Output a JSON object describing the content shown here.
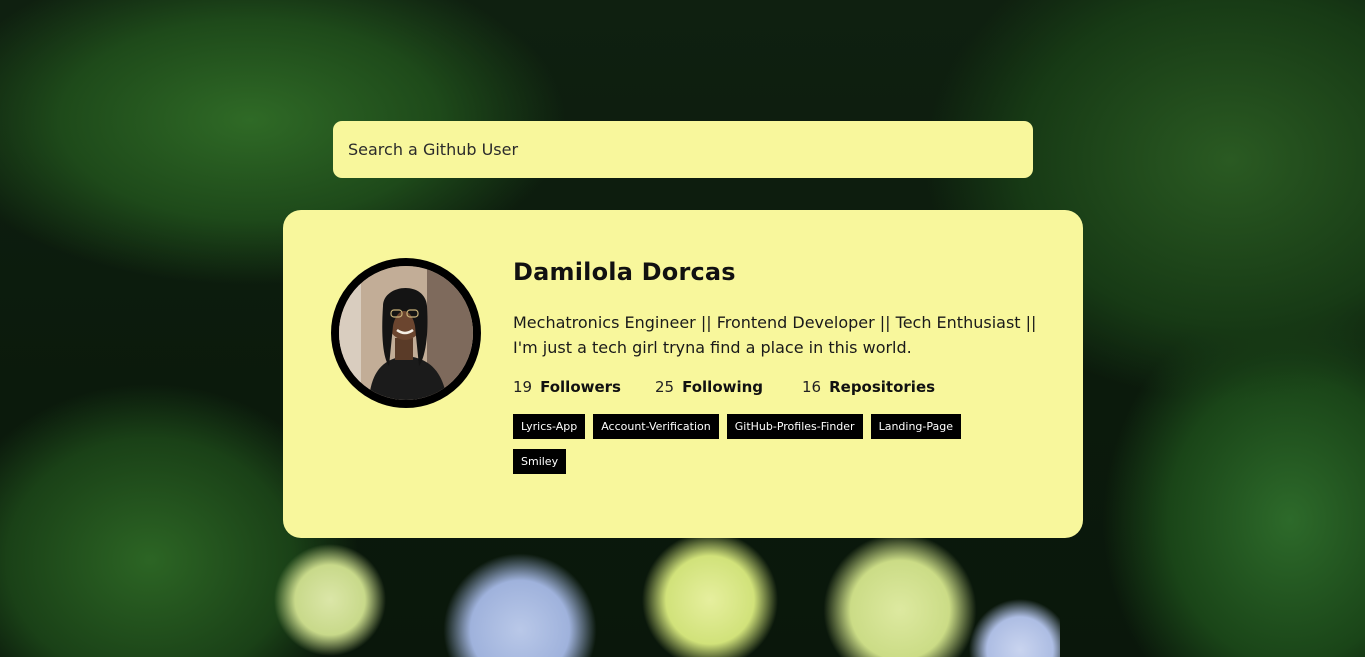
{
  "search": {
    "placeholder": "Search a Github User",
    "value": ""
  },
  "profile": {
    "name": "Damilola Dorcas",
    "bio": "Mechatronics Engineer || Frontend Developer || Tech Enthusiast || I'm just a tech girl tryna find a place in this world.",
    "stats": {
      "followers_count": "19",
      "followers_label": "Followers",
      "following_count": "25",
      "following_label": "Following",
      "repos_count": "16",
      "repos_label": "Repositories"
    },
    "repos": [
      "Lyrics-App",
      "Account-Verification",
      "GitHub-Profiles-Finder",
      "Landing-Page",
      "Smiley"
    ]
  },
  "colors": {
    "card": "#f8f79c",
    "tag": "#000000",
    "tag_text": "#ffffff"
  }
}
